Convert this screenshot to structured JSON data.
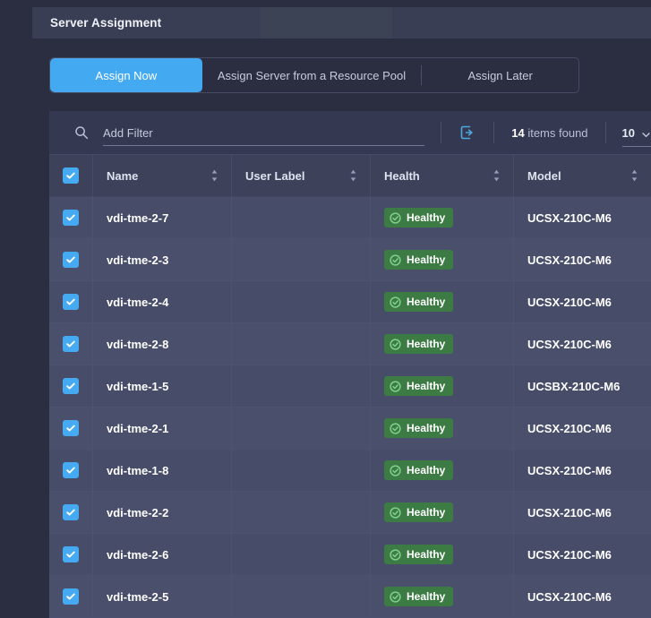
{
  "section": {
    "title": "Server Assignment"
  },
  "tabs": [
    {
      "label": "Assign Now",
      "active": true
    },
    {
      "label": "Assign Server from a Resource Pool",
      "active": false
    },
    {
      "label": "Assign Later",
      "active": false
    }
  ],
  "toolbar": {
    "search_icon": "search-icon",
    "filter_placeholder": "Add Filter",
    "filter_value": "",
    "refresh_icon": "refresh-icon",
    "items_count": "14",
    "items_found_label": "items found",
    "page_size_value": "10",
    "page_size_chevron": "chevron-down-icon"
  },
  "table": {
    "select_all_checked": true,
    "columns": [
      {
        "key": "check",
        "label": "",
        "sortable": false
      },
      {
        "key": "name",
        "label": "Name",
        "sortable": true
      },
      {
        "key": "user_label",
        "label": "User Label",
        "sortable": true
      },
      {
        "key": "health",
        "label": "Health",
        "sortable": true
      },
      {
        "key": "model",
        "label": "Model",
        "sortable": true
      }
    ],
    "rows": [
      {
        "checked": true,
        "name": "vdi-tme-2-7",
        "user_label": "",
        "health": "Healthy",
        "model": "UCSX-210C-M6"
      },
      {
        "checked": true,
        "name": "vdi-tme-2-3",
        "user_label": "",
        "health": "Healthy",
        "model": "UCSX-210C-M6"
      },
      {
        "checked": true,
        "name": "vdi-tme-2-4",
        "user_label": "",
        "health": "Healthy",
        "model": "UCSX-210C-M6"
      },
      {
        "checked": true,
        "name": "vdi-tme-2-8",
        "user_label": "",
        "health": "Healthy",
        "model": "UCSX-210C-M6"
      },
      {
        "checked": true,
        "name": "vdi-tme-1-5",
        "user_label": "",
        "health": "Healthy",
        "model": "UCSBX-210C-M6"
      },
      {
        "checked": true,
        "name": "vdi-tme-2-1",
        "user_label": "",
        "health": "Healthy",
        "model": "UCSX-210C-M6"
      },
      {
        "checked": true,
        "name": "vdi-tme-1-8",
        "user_label": "",
        "health": "Healthy",
        "model": "UCSX-210C-M6"
      },
      {
        "checked": true,
        "name": "vdi-tme-2-2",
        "user_label": "",
        "health": "Healthy",
        "model": "UCSX-210C-M6"
      },
      {
        "checked": true,
        "name": "vdi-tme-2-6",
        "user_label": "",
        "health": "Healthy",
        "model": "UCSX-210C-M6"
      },
      {
        "checked": true,
        "name": "vdi-tme-2-5",
        "user_label": "",
        "health": "Healthy",
        "model": "UCSX-210C-M6"
      }
    ]
  },
  "colors": {
    "accent_blue": "#43a9f0",
    "checkbox_blue": "#45aaf2",
    "health_green_bg": "#3d7b45",
    "health_green_icon": "#7ed08a",
    "refresh_icon": "#4fa8dd",
    "panel_bg": "#333751",
    "page_bg": "#2b2e40"
  }
}
